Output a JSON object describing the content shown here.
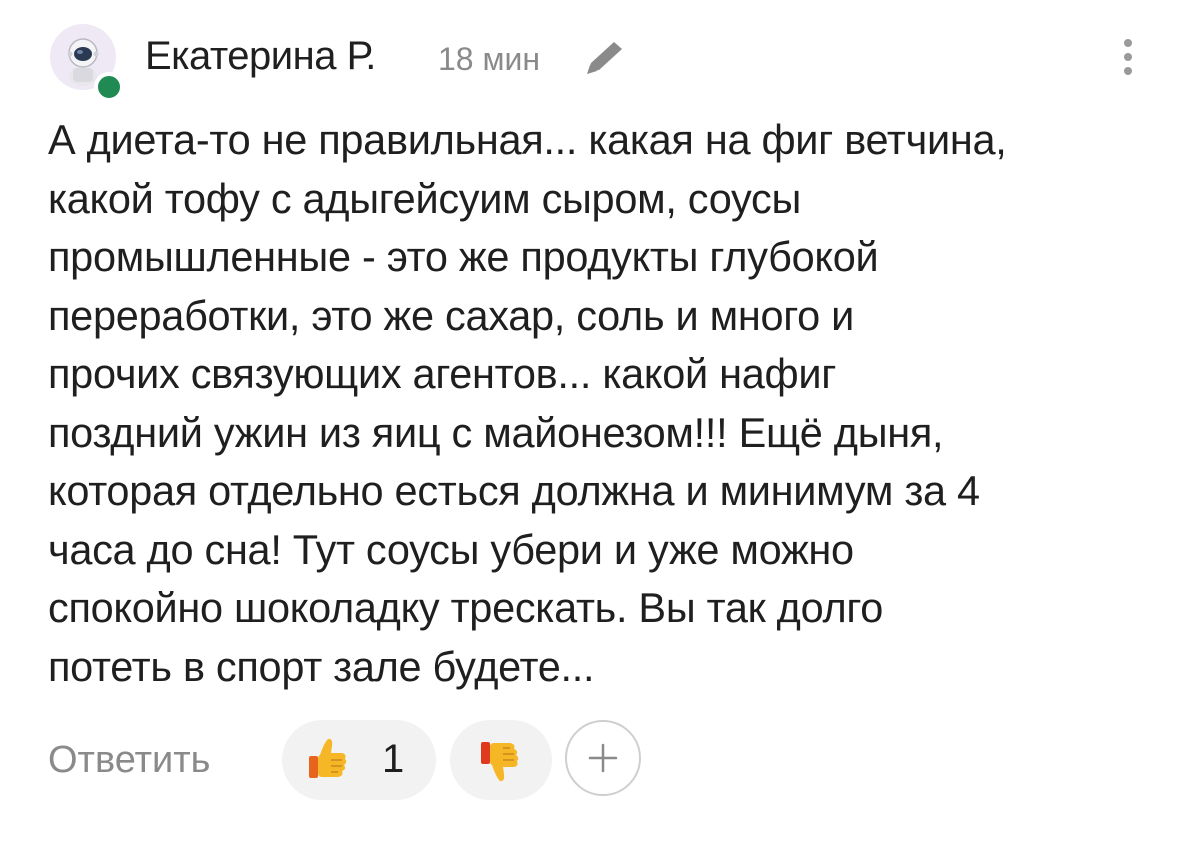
{
  "comment": {
    "author": "Екатерина Р.",
    "time": "18 мин",
    "status": "online",
    "body_lines": [
      "А диета-то не правильная... какая на фиг ветчина,",
      "какой тофу с адыгейсуим сыром, соусы",
      "промышленные - это же продукты глубокой",
      "переработки, это же сахар, соль и много и",
      "прочих связующих агентов... какой нафиг",
      "поздний ужин из яиц с майонезом!!! Ещё дыня,",
      "которая отдельно есться должна и минимум за 4",
      "часа до сна! Тут соусы убери и уже можно",
      "спокойно шоколадку трескать. Вы так долго",
      "потеть в спорт зале будете..."
    ],
    "actions": {
      "reply_label": "Ответить",
      "like_count": "1"
    },
    "icons": {
      "avatar": "astronaut-avatar-icon",
      "edited": "pencil-icon",
      "more": "more-vertical-icon",
      "like": "thumbs-up-emoji-icon",
      "dislike": "thumbs-down-emoji-icon",
      "add_reaction": "plus-icon"
    },
    "colors": {
      "online": "#1f8a52",
      "muted_text": "#8a8a8a",
      "pill_bg": "#f2f2f2",
      "emoji_yellow": "#f6b727"
    }
  }
}
